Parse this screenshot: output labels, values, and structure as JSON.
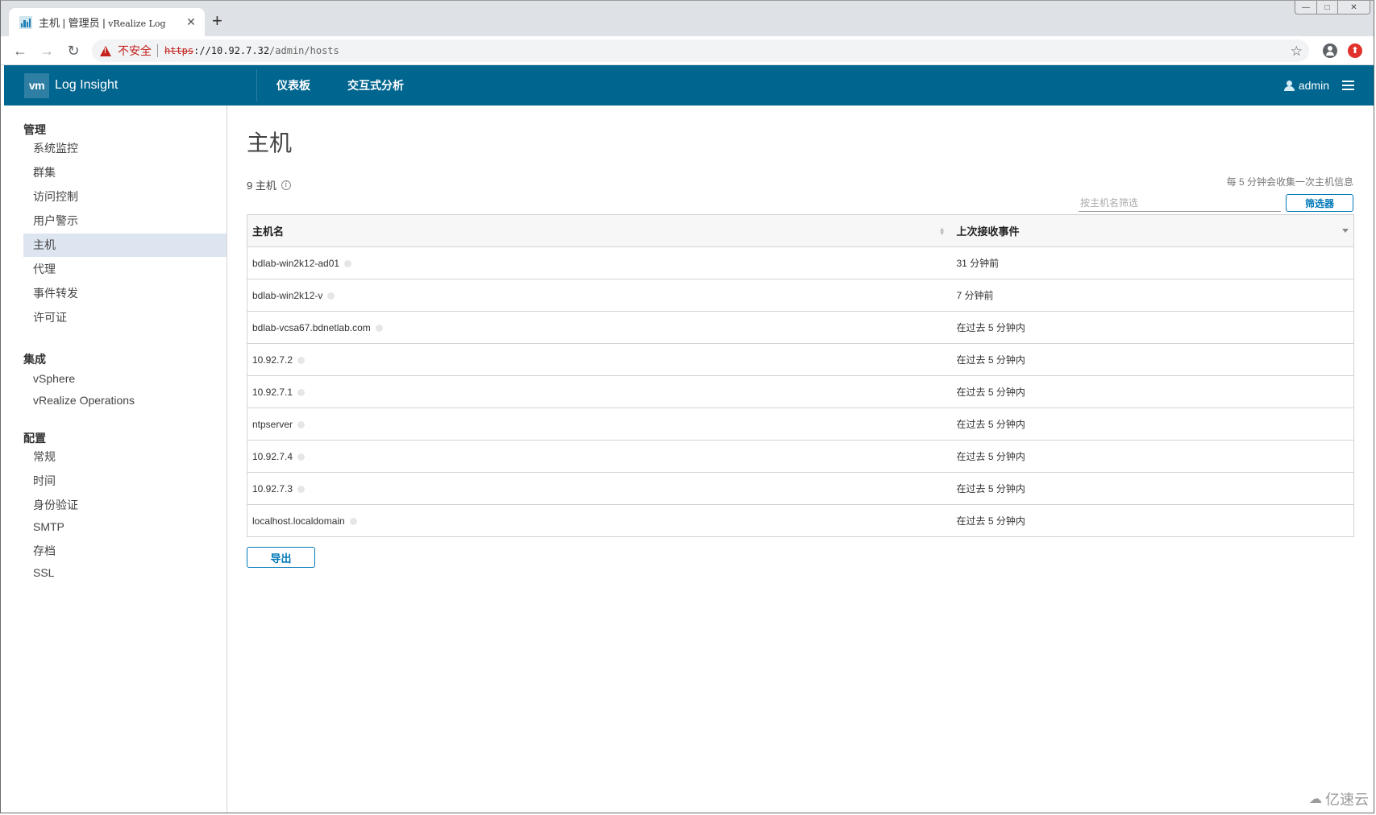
{
  "browser": {
    "tab_title_cn": "主机 | 管理员 | ",
    "tab_title_en": "vRealize Log",
    "tab_close": "✕",
    "new_tab": "+",
    "window_controls": {
      "minimize": "—",
      "maximize": "□",
      "close": "✕"
    },
    "nav": {
      "back": "←",
      "forward": "→",
      "reload": "↻"
    },
    "security_label": "不安全",
    "url_scheme": "https",
    "url_host": "://10.92.7.32",
    "url_path": "/admin/hosts",
    "star": "☆",
    "ext_badge": "⬆"
  },
  "app": {
    "logo": "vm",
    "brand": "Log Insight",
    "nav": [
      "仪表板",
      "交互式分析"
    ],
    "user": "admin"
  },
  "sidebar": {
    "groups": [
      {
        "label": "管理",
        "items": [
          "系统监控",
          "群集",
          "访问控制",
          "用户警示",
          "主机",
          "代理",
          "事件转发",
          "许可证"
        ]
      },
      {
        "label": "集成",
        "items": [
          "vSphere",
          "vRealize Operations"
        ]
      },
      {
        "label": "配置",
        "items": [
          "常规",
          "时间",
          "身份验证",
          "SMTP",
          "存档",
          "SSL"
        ]
      }
    ],
    "active_item": "主机"
  },
  "main": {
    "title": "主机",
    "count_label": "9 主机",
    "info_glyph": "i",
    "collect_note": "每 5 分钟会收集一次主机信息",
    "filter_placeholder": "按主机名筛选",
    "filter_value": "",
    "filter_button": "筛选器",
    "columns": [
      "主机名",
      "上次接收事件"
    ],
    "rows": [
      {
        "host": "bdlab-win2k12-ad01",
        "last_event": "31 分钟前"
      },
      {
        "host": "bdlab-win2k12-v",
        "last_event": "7 分钟前"
      },
      {
        "host": "bdlab-vcsa67.bdnetlab.com",
        "last_event": "在过去 5 分钟内"
      },
      {
        "host": "10.92.7.2",
        "last_event": "在过去 5 分钟内"
      },
      {
        "host": "10.92.7.1",
        "last_event": "在过去 5 分钟内"
      },
      {
        "host": "ntpserver",
        "last_event": "在过去 5 分钟内"
      },
      {
        "host": "10.92.7.4",
        "last_event": "在过去 5 分钟内"
      },
      {
        "host": "10.92.7.3",
        "last_event": "在过去 5 分钟内"
      },
      {
        "host": "localhost.localdomain",
        "last_event": "在过去 5 分钟内"
      }
    ],
    "export_button": "导出"
  },
  "watermark": {
    "icon": "☁",
    "text": "亿速云"
  },
  "colors": {
    "header_bg": "#00658f",
    "accent": "#0079b8",
    "active_item_bg": "#dde6f0",
    "insecure": "#c5221f"
  }
}
